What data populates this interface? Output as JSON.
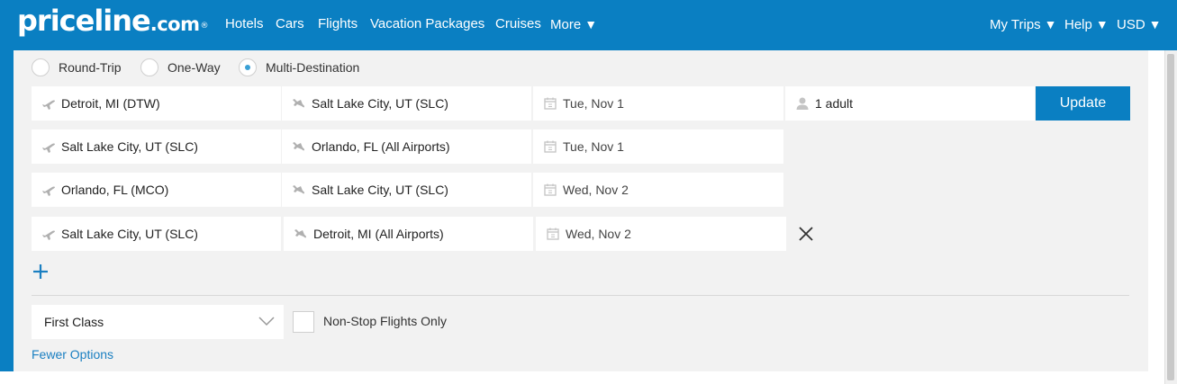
{
  "header": {
    "logo": {
      "main": "priceline",
      "suffix": ".com",
      "mark": "®"
    },
    "nav_left": [
      {
        "label": "Hotels"
      },
      {
        "label": "Cars"
      },
      {
        "label": "Flights"
      },
      {
        "label": "Vacation Packages"
      },
      {
        "label": "Cruises"
      },
      {
        "label": "More",
        "caret": "▼"
      }
    ],
    "nav_right": [
      {
        "label": "My Trips",
        "caret": "▼"
      },
      {
        "label": "Help",
        "caret": "▼"
      },
      {
        "label": "USD",
        "caret": "▼"
      }
    ]
  },
  "trip_type": {
    "options": [
      {
        "label": "Round-Trip",
        "selected": false
      },
      {
        "label": "One-Way",
        "selected": false
      },
      {
        "label": "Multi-Destination",
        "selected": true
      }
    ]
  },
  "legs": [
    {
      "from": "Detroit, MI (DTW)",
      "to": "Salt Lake City, UT (SLC)",
      "date": "Tue, Nov 1"
    },
    {
      "from": "Salt Lake City, UT (SLC)",
      "to": "Orlando, FL (All Airports)",
      "date": "Tue, Nov 1"
    },
    {
      "from": "Orlando, FL (MCO)",
      "to": "Salt Lake City, UT (SLC)",
      "date": "Wed, Nov 2"
    },
    {
      "from": "Salt Lake City, UT (SLC)",
      "to": "Detroit, MI (All Airports)",
      "date": "Wed, Nov 2"
    }
  ],
  "travelers": {
    "value": "1 adult"
  },
  "actions": {
    "update_label": "Update"
  },
  "cabin": {
    "selected": "First Class"
  },
  "nonstop": {
    "label": "Non-Stop Flights Only",
    "checked": false
  },
  "options_link": {
    "label": "Fewer Options"
  },
  "colors": {
    "brand": "#0a7fc2",
    "panel": "#f2f2f2",
    "link": "#1a7fc1"
  }
}
